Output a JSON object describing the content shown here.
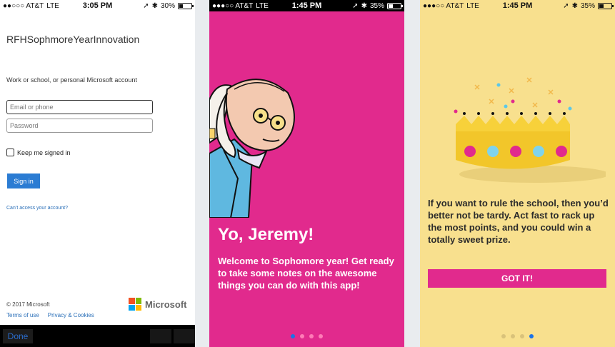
{
  "colors": {
    "ms_blue": "#2b7cd3",
    "pink": "#e12a8d",
    "yellow": "#f8e08e",
    "dot_active": "#1a73e8"
  },
  "screen1": {
    "status": {
      "carrier": "●●○○○ AT&T",
      "network": "LTE",
      "time": "3:05 PM",
      "battery": "30%",
      "battery_level": 0.3
    },
    "title": "RFHSophmoreYearInnovation",
    "prompt": "Work or school, or personal Microsoft account",
    "email_placeholder": "Email or phone",
    "password_placeholder": "Password",
    "keep_signed_in": "Keep me signed in",
    "sign_in": "Sign in",
    "cant_access": "Can’t access your account?",
    "copyright": "© 2017 Microsoft",
    "terms": "Terms of use",
    "privacy": "Privacy & Cookies",
    "logo_text": "Microsoft",
    "done": "Done"
  },
  "screen2": {
    "status": {
      "carrier": "●●●○○ AT&T",
      "network": "LTE",
      "time": "1:45 PM",
      "battery": "35%",
      "battery_level": 0.35
    },
    "heading": "Yo, Jeremy!",
    "body": "Welcome to Sophomore year! Get ready to take some notes on the awesome things you can do with this app!",
    "page_index": 1,
    "page_count": 4
  },
  "screen3": {
    "status": {
      "carrier": "●●●○○ AT&T",
      "network": "LTE",
      "time": "1:45 PM",
      "battery": "35%",
      "battery_level": 0.35
    },
    "body": "If you want to rule the school, then you’d better not be tardy. Act fast to rack up the most points, and you could win a totally sweet prize.",
    "button": "GOT IT!",
    "page_index": 4,
    "page_count": 4
  }
}
